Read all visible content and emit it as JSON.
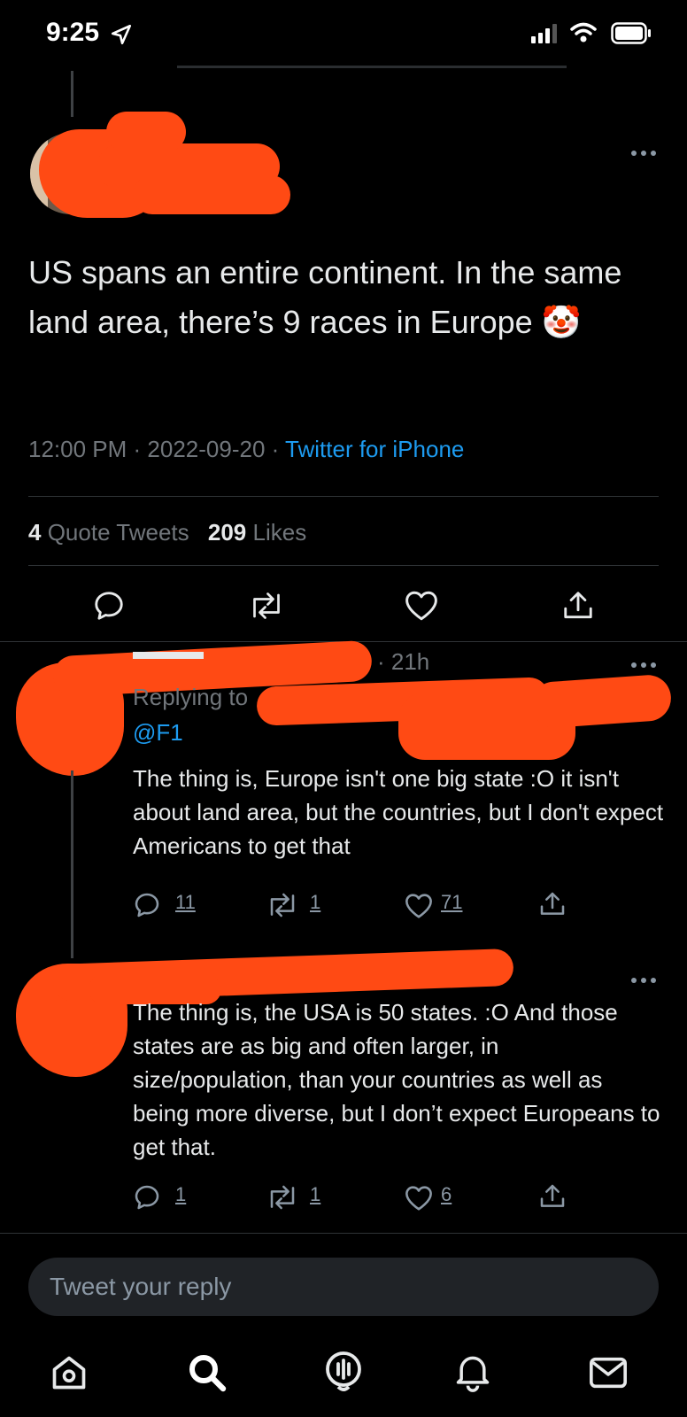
{
  "status_bar": {
    "time": "9:25"
  },
  "tweet": {
    "text": "US spans an entire continent. In the same land area, there’s 9 races in Europe",
    "emoji": "🤡",
    "time": "12:00 PM",
    "date": "2022-09-20",
    "source": "Twitter for iPhone",
    "quote_count": "4",
    "quote_label": "Quote Tweets",
    "like_count": "209",
    "like_label": "Likes"
  },
  "replies": [
    {
      "meta": "· 21h",
      "replying_to": "Replying to",
      "mention": "@F1",
      "text": "The thing is, Europe isn't one big state :O it isn't about land area, but the countries, but I don't expect Americans to get that",
      "reply_count": "11",
      "retweet_count": "1",
      "like_count": "71"
    },
    {
      "text": "The thing is, the USA is 50 states. :O And those states are as big and often larger, in size/population, than your countries as well as being more diverse, but I don’t expect Europeans to get that.",
      "reply_count": "1",
      "retweet_count": "1",
      "like_count": "6"
    }
  ],
  "composer": {
    "placeholder": "Tweet your reply"
  },
  "nav": {
    "items": [
      "home",
      "search",
      "spaces",
      "notifications",
      "messages"
    ]
  },
  "colors": {
    "background": "#000000",
    "accent": "#1d9bf0",
    "redaction": "#ff4a14",
    "muted": "#71767b"
  }
}
